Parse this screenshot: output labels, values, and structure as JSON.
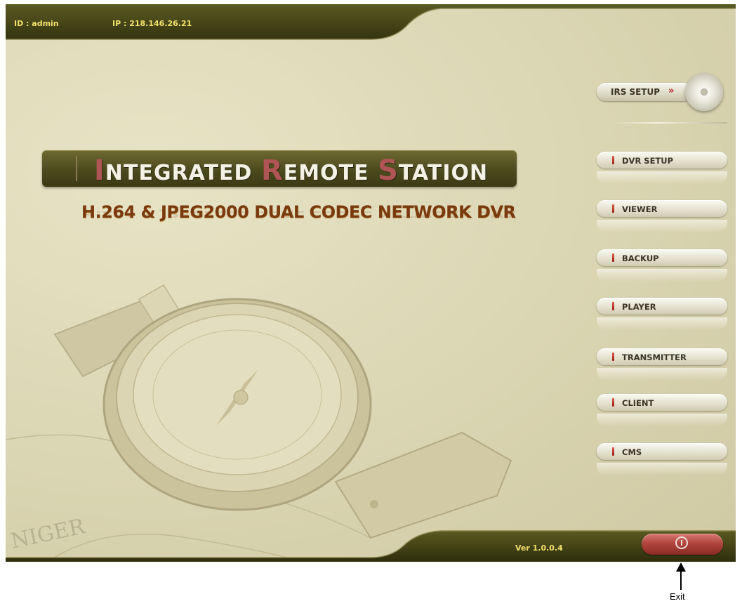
{
  "header": {
    "id_text": "ID : admin",
    "ip_text": "IP : 218.146.26.21"
  },
  "title": {
    "word1_initial": "I",
    "word1_rest": "NTEGRATED",
    "word2_initial": "R",
    "word2_rest": "EMOTE",
    "word3_initial": "S",
    "word3_rest": "TATION",
    "subtitle": "H.264 & JPEG2000 DUAL CODEC NETWORK DVR"
  },
  "irs_setup": {
    "label": "IRS SETUP",
    "arrow_glyph": "»",
    "icon": "disc-icon"
  },
  "menu": {
    "items": [
      {
        "label": "DVR SETUP"
      },
      {
        "label": "VIEWER"
      },
      {
        "label": "BACKUP"
      },
      {
        "label": "PLAYER"
      },
      {
        "label": "TRANSMITTER"
      },
      {
        "label": "CLIENT"
      },
      {
        "label": "CMS"
      }
    ]
  },
  "footer": {
    "version": "Ver 1.0.0.4",
    "exit_icon": "power-icon"
  },
  "annotation": {
    "exit_label": "Exit"
  },
  "colors": {
    "header_text": "#f2e06a",
    "banner_bg": "#4c4a1e",
    "accent_red": "#b05555",
    "exit_red": "#b0463e",
    "subtitle": "#7a3a0e"
  },
  "background_art_text": "NIGER"
}
